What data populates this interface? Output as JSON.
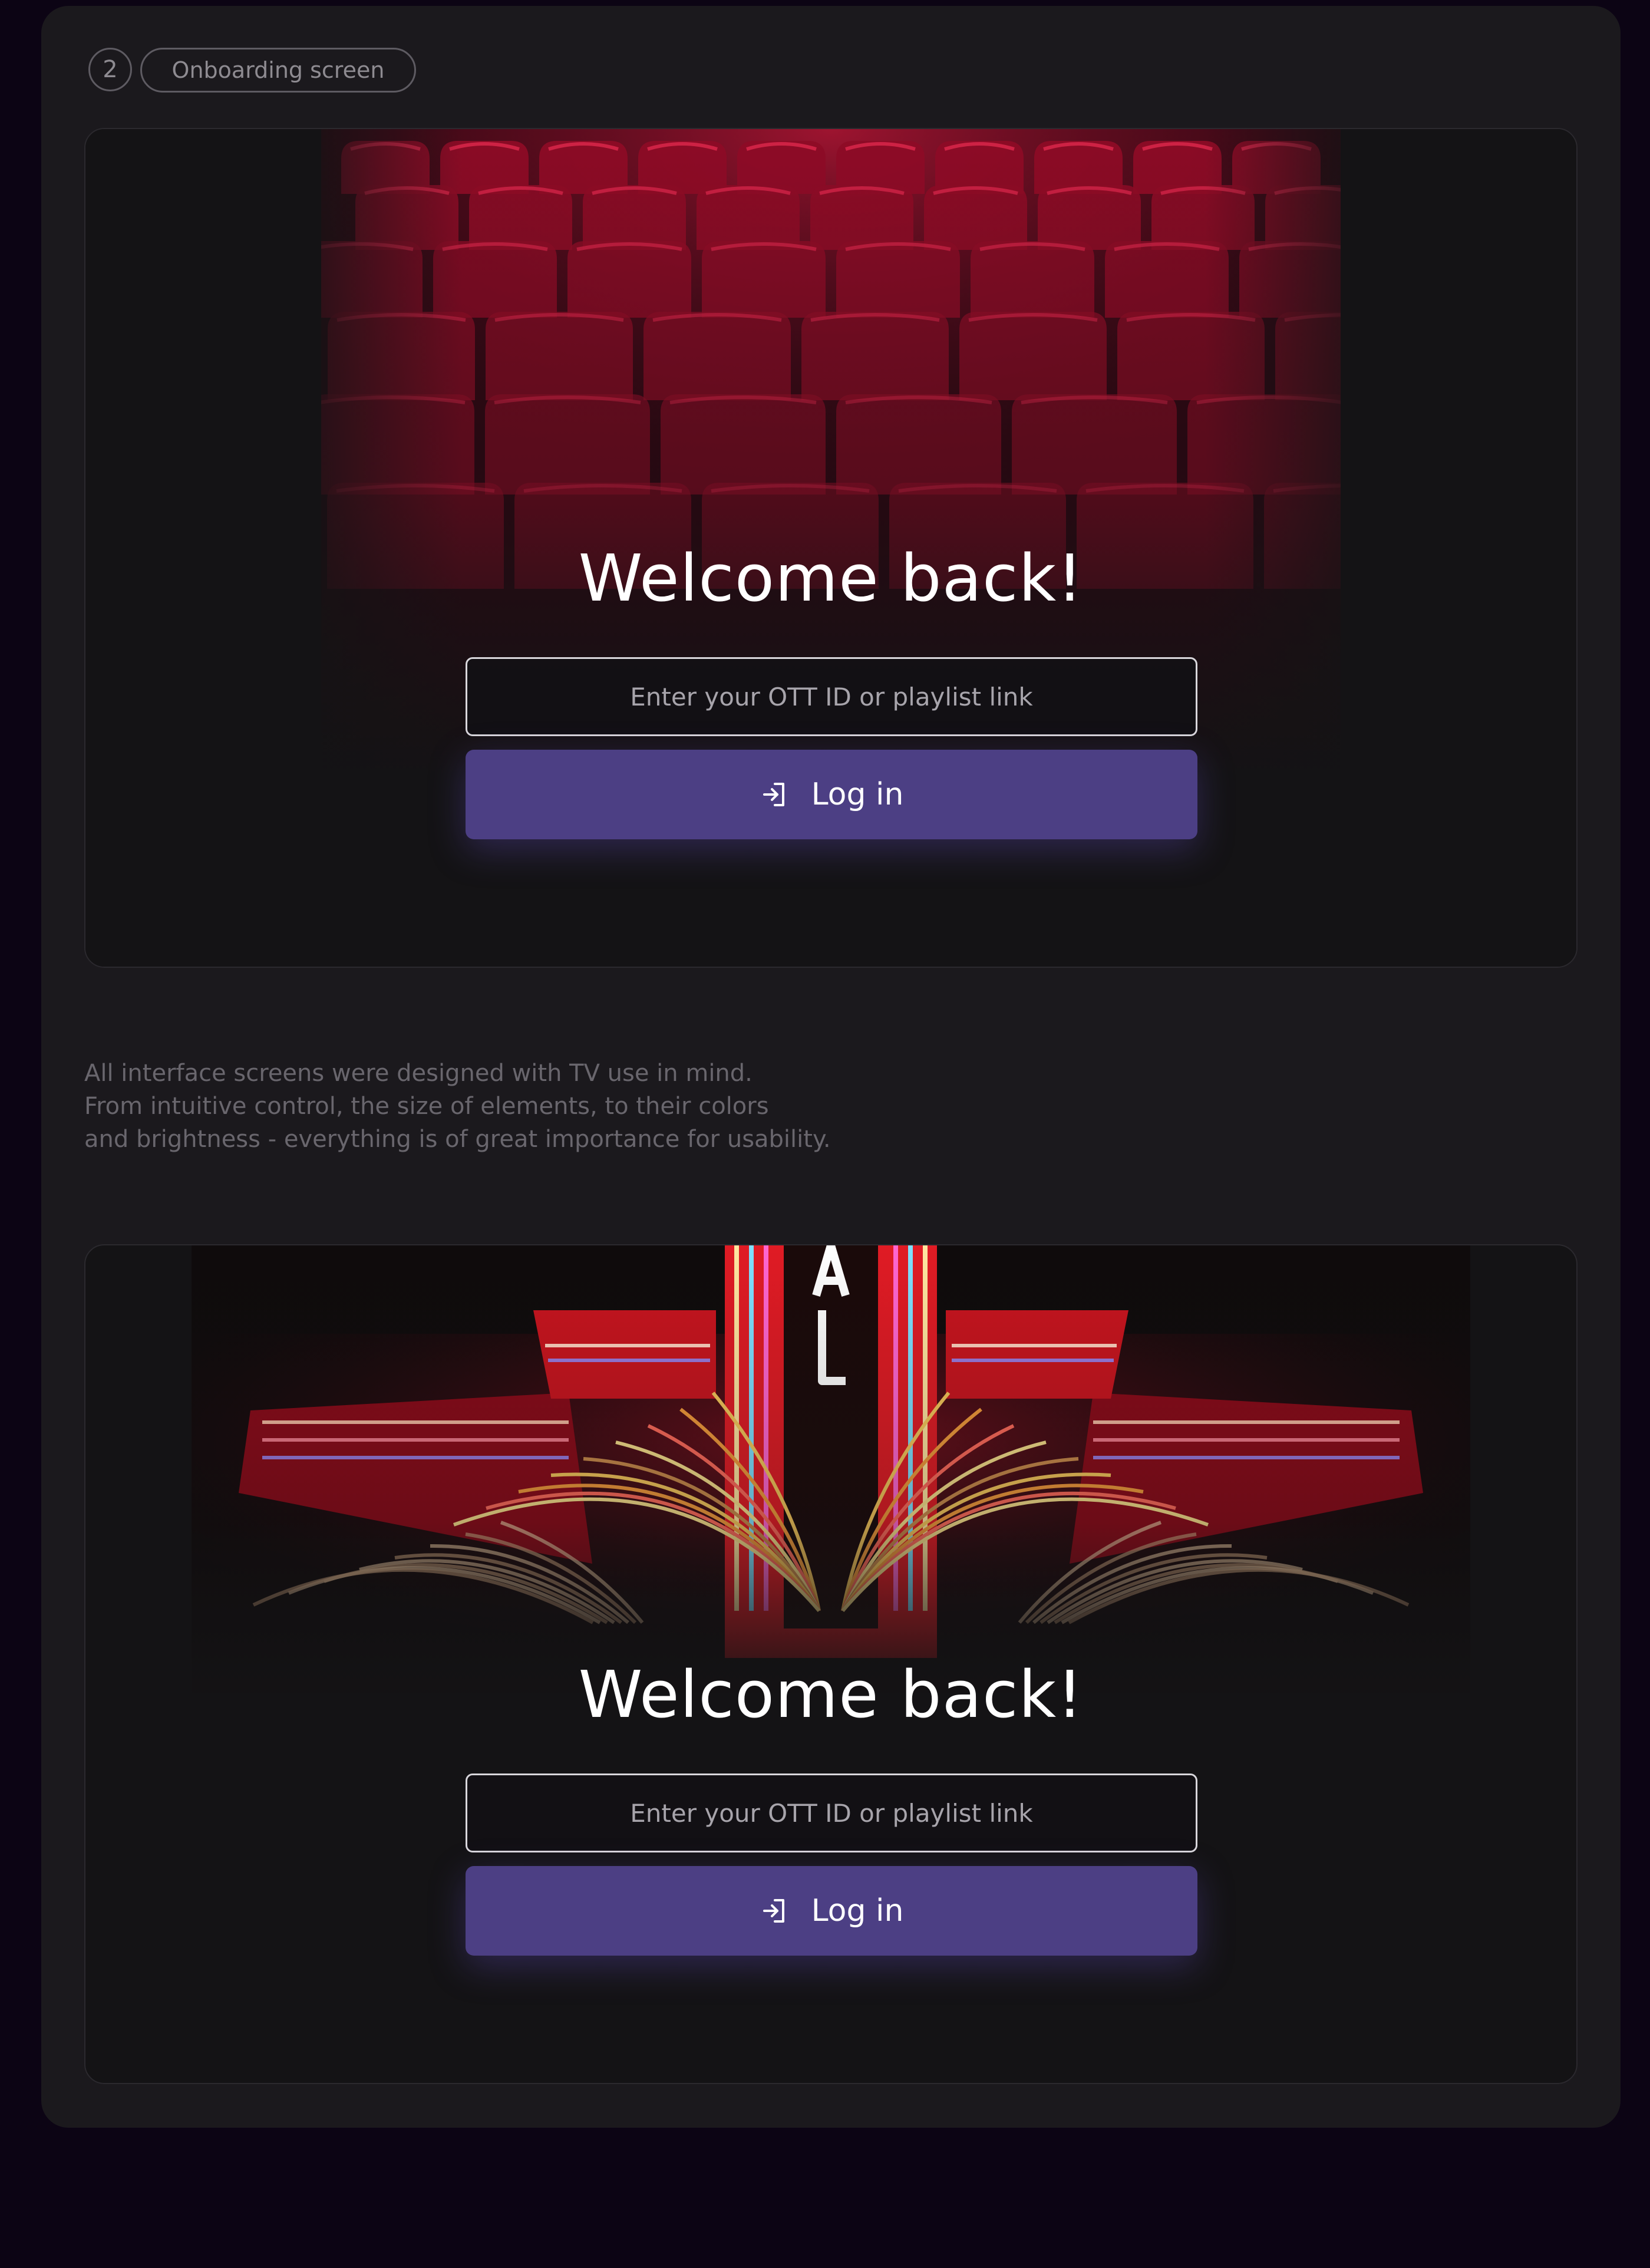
{
  "header": {
    "step_number": "2",
    "section_label": "Onboarding screen"
  },
  "screens": [
    {
      "background": "theater-seats-photo",
      "title": "Welcome back!",
      "input_placeholder": "Enter your OTT ID or playlist link",
      "login_label": "Log in",
      "login_icon": "login-arrow-icon"
    },
    {
      "background": "neon-marquee-photo",
      "title": "Welcome back!",
      "input_placeholder": "Enter your OTT ID or playlist link",
      "login_label": "Log in",
      "login_icon": "login-arrow-icon"
    }
  ],
  "description": {
    "lines": [
      "All interface screens were designed with TV use in mind.",
      "From intuitive control, the size of elements, to their colors",
      "and brightness - everything is of great importance for usability."
    ]
  },
  "colors": {
    "page_background": "#0c0414",
    "card_background": "#1b191d",
    "accent_button": "#4c3f84",
    "seat_red": "#a3102c"
  }
}
